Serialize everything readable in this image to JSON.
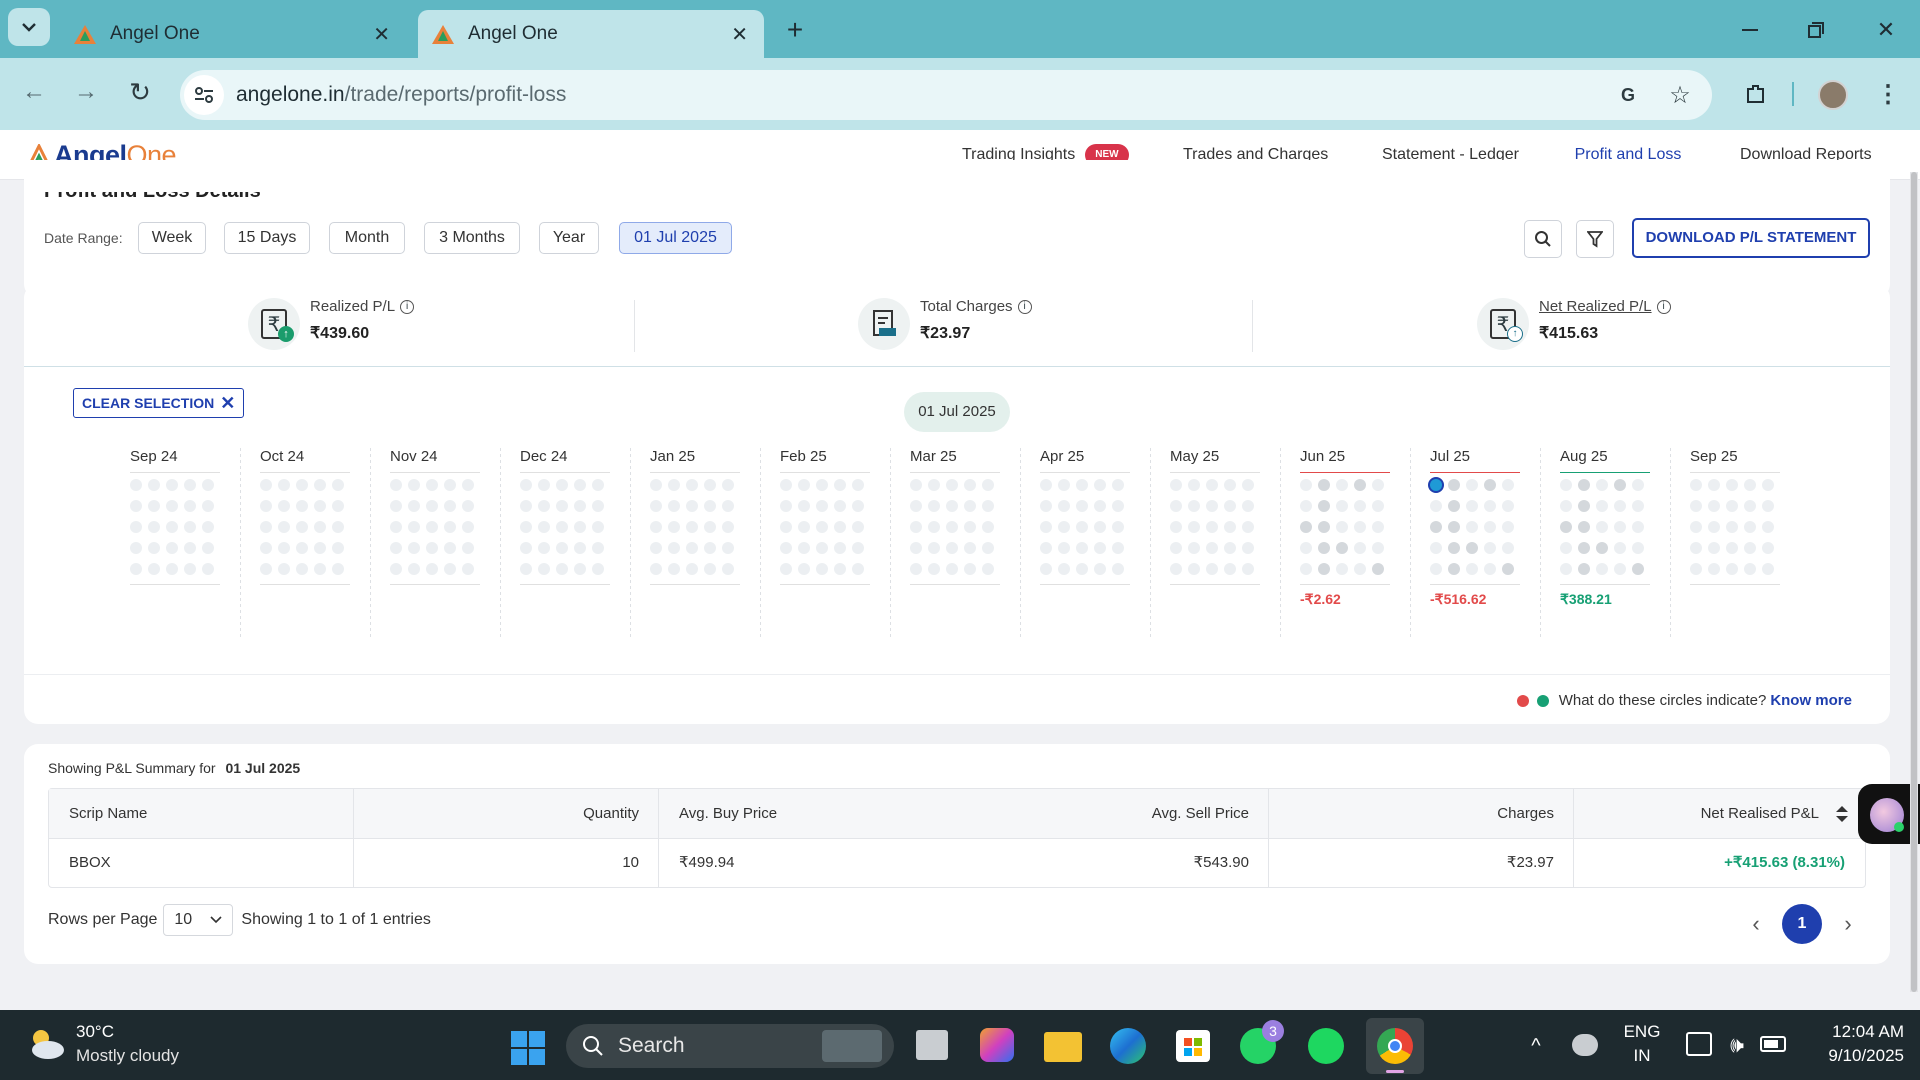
{
  "browser": {
    "tabs": [
      {
        "title": "Angel One"
      },
      {
        "title": "Angel One"
      }
    ],
    "url_domain": "angelone.in",
    "url_path": "/trade/reports/profit-loss"
  },
  "nav": {
    "logo_angel": "Angel",
    "logo_one": "One",
    "items": [
      "Trading Insights",
      "Trades and Charges",
      "Statement - Ledger",
      "Profit and Loss",
      "Download Reports"
    ],
    "new_badge": "NEW",
    "active": "Profit and Loss"
  },
  "filters": {
    "section_title": "Profit and Loss Details",
    "date_range_label": "Date Range:",
    "ranges": [
      "Week",
      "15 Days",
      "Month",
      "3 Months",
      "Year",
      "01 Jul 2025"
    ],
    "selected": "01 Jul 2025",
    "download_label": "DOWNLOAD P/L STATEMENT"
  },
  "summary": {
    "realized_label": "Realized P/L",
    "realized_value": "₹439.60",
    "charges_label": "Total Charges",
    "charges_value": "₹23.97",
    "net_label": "Net Realized P/L",
    "net_value": "₹415.63"
  },
  "calendar": {
    "clear_label": "CLEAR SELECTION",
    "selected_date": "01 Jul 2025",
    "months": [
      {
        "name": "Sep 24",
        "value": ""
      },
      {
        "name": "Oct 24",
        "value": ""
      },
      {
        "name": "Nov 24",
        "value": ""
      },
      {
        "name": "Dec 24",
        "value": ""
      },
      {
        "name": "Jan 25",
        "value": ""
      },
      {
        "name": "Feb 25",
        "value": ""
      },
      {
        "name": "Mar 25",
        "value": ""
      },
      {
        "name": "Apr 25",
        "value": ""
      },
      {
        "name": "May 25",
        "value": ""
      },
      {
        "name": "Jun 25",
        "value": "-₹2.62",
        "status": "loss"
      },
      {
        "name": "Jul 25",
        "value": "-₹516.62",
        "status": "loss"
      },
      {
        "name": "Aug 25",
        "value": "₹388.21",
        "status": "profit"
      },
      {
        "name": "Sep 25",
        "value": ""
      }
    ],
    "legend_question": "What do these circles indicate?",
    "legend_link": "Know more",
    "colors": {
      "loss": "#e24a4a",
      "profit": "#17a074",
      "accent": "#1f3fae"
    }
  },
  "table": {
    "showing_label": "Showing P&L Summary for",
    "showing_date": "01 Jul 2025",
    "columns": [
      "Scrip Name",
      "Quantity",
      "Avg. Buy Price",
      "Avg. Sell Price",
      "Charges",
      "Net Realised P&L"
    ],
    "rows": [
      [
        "BBOX",
        "10",
        "₹499.94",
        "₹543.90",
        "₹23.97",
        "+₹415.63 (8.31%)"
      ]
    ],
    "rows_per_page_label": "Rows per Page",
    "rows_per_page": "10",
    "entries_text": "Showing 1 to 1 of 1 entries",
    "page": "1"
  },
  "taskbar": {
    "temp": "30°C",
    "weather": "Mostly cloudy",
    "search": "Search",
    "lang1": "ENG",
    "lang2": "IN",
    "time": "12:04 AM",
    "date": "9/10/2025",
    "whatsapp_badge": "3"
  }
}
